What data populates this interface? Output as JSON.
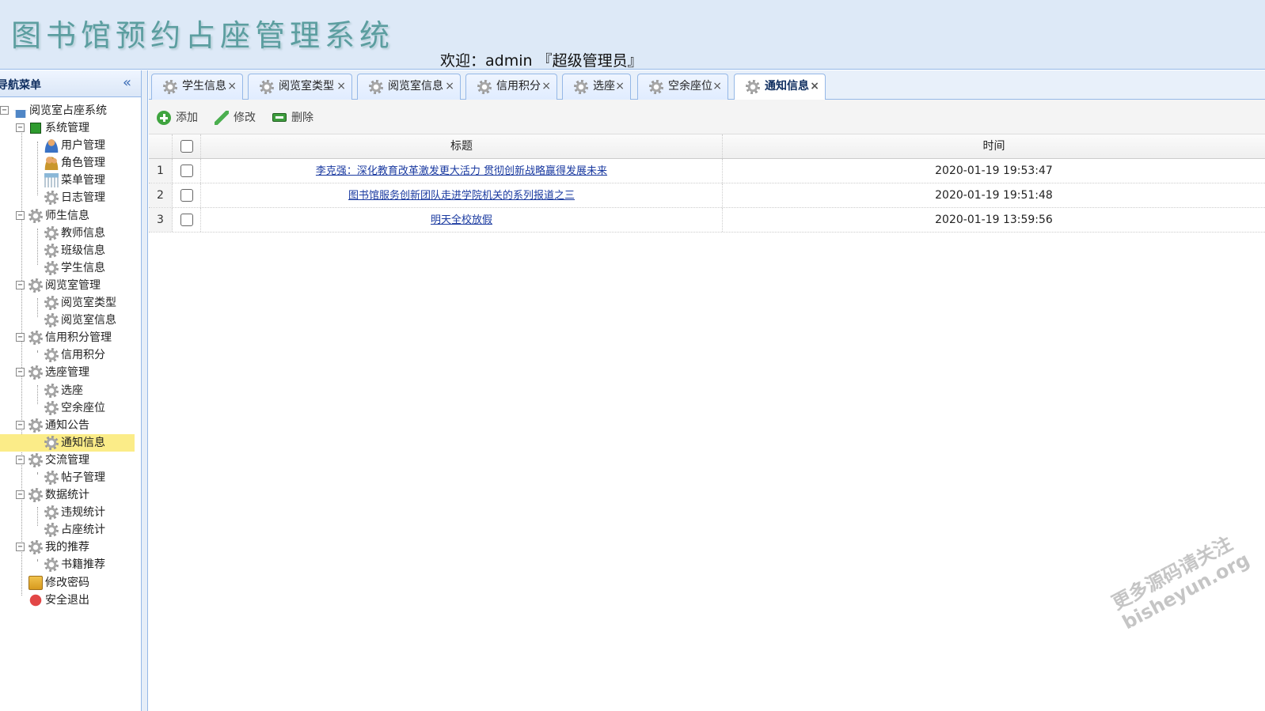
{
  "header": {
    "app_title": "图书馆预约占座管理系统",
    "welcome": "欢迎：admin 『超级管理员』"
  },
  "sidebar": {
    "title": "导航菜单",
    "collapse_glyph": "«",
    "tree": [
      {
        "label": "阅览室占座系统",
        "icon": "home-icon"
      },
      {
        "label": "系统管理",
        "icon": "folder-green-icon"
      },
      {
        "label": "用户管理",
        "icon": "user-icon"
      },
      {
        "label": "角色管理",
        "icon": "role-icon"
      },
      {
        "label": "菜单管理",
        "icon": "menu-icon"
      },
      {
        "label": "日志管理",
        "icon": "gear-icon"
      },
      {
        "label": "师生信息",
        "icon": "gear-icon"
      },
      {
        "label": "教师信息",
        "icon": "gear-icon"
      },
      {
        "label": "班级信息",
        "icon": "gear-icon"
      },
      {
        "label": "学生信息",
        "icon": "gear-icon"
      },
      {
        "label": "阅览室管理",
        "icon": "gear-icon"
      },
      {
        "label": "阅览室类型",
        "icon": "gear-icon"
      },
      {
        "label": "阅览室信息",
        "icon": "gear-icon"
      },
      {
        "label": "信用积分管理",
        "icon": "gear-icon"
      },
      {
        "label": "信用积分",
        "icon": "gear-icon"
      },
      {
        "label": "选座管理",
        "icon": "gear-icon"
      },
      {
        "label": "选座",
        "icon": "gear-icon"
      },
      {
        "label": "空余座位",
        "icon": "gear-icon"
      },
      {
        "label": "通知公告",
        "icon": "gear-icon"
      },
      {
        "label": "通知信息",
        "icon": "gear-icon"
      },
      {
        "label": "交流管理",
        "icon": "gear-icon"
      },
      {
        "label": "帖子管理",
        "icon": "gear-icon"
      },
      {
        "label": "数据统计",
        "icon": "gear-icon"
      },
      {
        "label": "违规统计",
        "icon": "gear-icon"
      },
      {
        "label": "占座统计",
        "icon": "gear-icon"
      },
      {
        "label": "我的推荐",
        "icon": "gear-icon"
      },
      {
        "label": "书籍推荐",
        "icon": "gear-icon"
      },
      {
        "label": "修改密码",
        "icon": "lock-icon"
      },
      {
        "label": "安全退出",
        "icon": "exit-icon"
      }
    ]
  },
  "tabs": [
    {
      "label": "学生信息",
      "active": false
    },
    {
      "label": "阅览室类型",
      "active": false
    },
    {
      "label": "阅览室信息",
      "active": false
    },
    {
      "label": "信用积分",
      "active": false
    },
    {
      "label": "选座",
      "active": false
    },
    {
      "label": "空余座位",
      "active": false
    },
    {
      "label": "通知信息",
      "active": true
    }
  ],
  "tab_close_glyph": "×",
  "toolbar": {
    "add": "添加",
    "edit": "修改",
    "delete": "删除"
  },
  "grid": {
    "columns": {
      "title": "标题",
      "time": "时间"
    },
    "rows": [
      {
        "num": "1",
        "title": "李克强：深化教育改革激发更大活力 贯彻创新战略赢得发展未来",
        "time": "2020-01-19 19:53:47"
      },
      {
        "num": "2",
        "title": "图书馆服务创新团队走进学院机关的系列报道之三",
        "time": "2020-01-19 19:51:48"
      },
      {
        "num": "3",
        "title": "明天全校放假",
        "time": "2020-01-19 13:59:56"
      }
    ]
  },
  "watermark": {
    "line1": "更多源码请关注",
    "line2": "bisheyun.org"
  }
}
